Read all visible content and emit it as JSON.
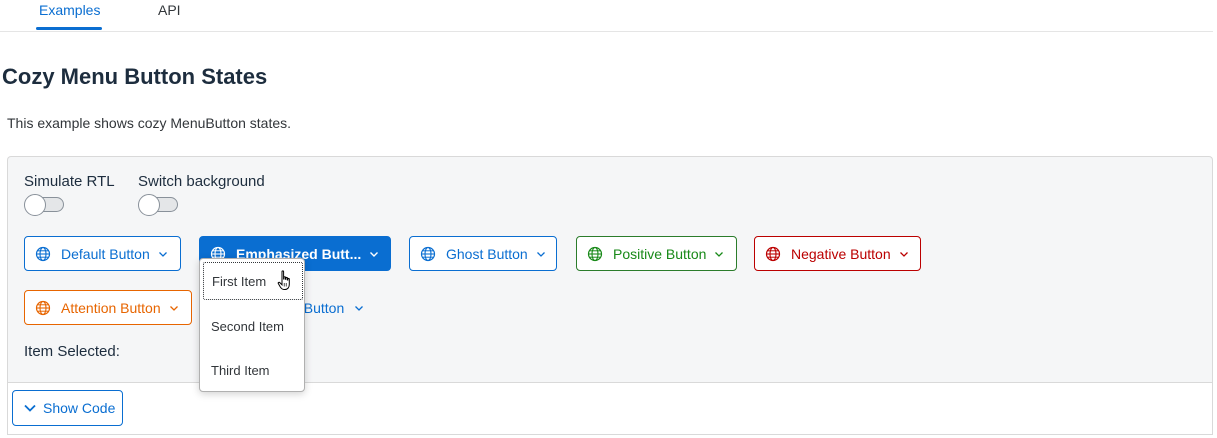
{
  "tabs": [
    {
      "label": "Examples"
    },
    {
      "label": "API"
    }
  ],
  "page_title": "Cozy Menu Button States",
  "description": "This example shows cozy MenuButton states.",
  "switches": {
    "rtl_label": "Simulate RTL",
    "background_label": "Switch background"
  },
  "buttons": {
    "default": "Default Button",
    "emphasized": "Emphasized Butt...",
    "ghost": "Ghost Button",
    "positive": "Positive Button",
    "negative": "Negative Button",
    "attention": "Attention Button",
    "transparent_partial": "t Button"
  },
  "menu": {
    "items": [
      {
        "label": "First Item"
      },
      {
        "label": "Second Item"
      },
      {
        "label": "Third Item"
      }
    ]
  },
  "item_selected_label": "Item Selected:",
  "show_code_label": "Show Code",
  "colors": {
    "accent": "#0a6ed1",
    "positive": "#188918",
    "negative": "#bb0000",
    "attention": "#e76500"
  },
  "icons": [
    "globe-icon",
    "chevron-down-icon",
    "pointer-hand-cursor"
  ]
}
